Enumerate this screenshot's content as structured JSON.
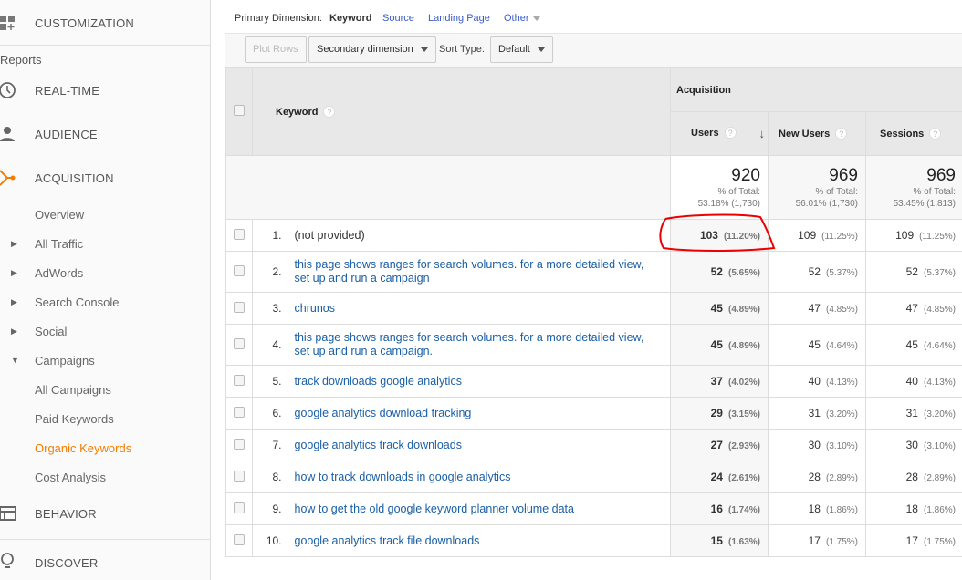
{
  "sidebar": {
    "customization": "CUSTOMIZATION",
    "reports": "Reports",
    "realtime": "REAL-TIME",
    "audience": "AUDIENCE",
    "acquisition": "ACQUISITION",
    "sub": [
      "Overview",
      "All Traffic",
      "AdWords",
      "Search Console",
      "Social",
      "Campaigns",
      "All Campaigns",
      "Paid Keywords",
      "Organic Keywords",
      "Cost Analysis"
    ],
    "behavior": "BEHAVIOR",
    "discover": "DISCOVER",
    "accent": "#f57c00"
  },
  "primary": {
    "label": "Primary Dimension:",
    "active": "Keyword",
    "source": "Source",
    "landing": "Landing Page",
    "other": "Other"
  },
  "toolbar": {
    "plot_rows": "Plot Rows",
    "secondary": "Secondary dimension",
    "sort_label": "Sort Type:",
    "sort_value": "Default"
  },
  "table": {
    "keyword_header": "Keyword",
    "group": "Acquisition",
    "cols": [
      "Users",
      "New Users",
      "Sessions"
    ],
    "totals": [
      {
        "value": "920",
        "label": "% of Total:",
        "detail": "53.18% (1,730)"
      },
      {
        "value": "969",
        "label": "% of Total:",
        "detail": "56.01% (1,730)"
      },
      {
        "value": "969",
        "label": "% of Total:",
        "detail": "53.45% (1,813)"
      }
    ],
    "rows": [
      {
        "idx": "1.",
        "kw": "(not provided)",
        "u": "103",
        "up": "(11.20%)",
        "n": "109",
        "np": "(11.25%)",
        "s": "109",
        "sp": "(11.25%)"
      },
      {
        "idx": "2.",
        "kw": "this page shows ranges for search volumes. for a more detailed view, set up and run a campaign",
        "u": "52",
        "up": "(5.65%)",
        "n": "52",
        "np": "(5.37%)",
        "s": "52",
        "sp": "(5.37%)"
      },
      {
        "idx": "3.",
        "kw": "chrunos",
        "u": "45",
        "up": "(4.89%)",
        "n": "47",
        "np": "(4.85%)",
        "s": "47",
        "sp": "(4.85%)"
      },
      {
        "idx": "4.",
        "kw": "this page shows ranges for search volumes. for a more detailed view, set up and run a campaign.",
        "u": "45",
        "up": "(4.89%)",
        "n": "45",
        "np": "(4.64%)",
        "s": "45",
        "sp": "(4.64%)"
      },
      {
        "idx": "5.",
        "kw": "track downloads google analytics",
        "u": "37",
        "up": "(4.02%)",
        "n": "40",
        "np": "(4.13%)",
        "s": "40",
        "sp": "(4.13%)"
      },
      {
        "idx": "6.",
        "kw": "google analytics download tracking",
        "u": "29",
        "up": "(3.15%)",
        "n": "31",
        "np": "(3.20%)",
        "s": "31",
        "sp": "(3.20%)"
      },
      {
        "idx": "7.",
        "kw": "google analytics track downloads",
        "u": "27",
        "up": "(2.93%)",
        "n": "30",
        "np": "(3.10%)",
        "s": "30",
        "sp": "(3.10%)"
      },
      {
        "idx": "8.",
        "kw": "how to track downloads in google analytics",
        "u": "24",
        "up": "(2.61%)",
        "n": "28",
        "np": "(2.89%)",
        "s": "28",
        "sp": "(2.89%)"
      },
      {
        "idx": "9.",
        "kw": "how to get the old google keyword planner volume data",
        "u": "16",
        "up": "(1.74%)",
        "n": "18",
        "np": "(1.86%)",
        "s": "18",
        "sp": "(1.86%)"
      },
      {
        "idx": "10.",
        "kw": "google analytics track file downloads",
        "u": "15",
        "up": "(1.63%)",
        "n": "17",
        "np": "(1.75%)",
        "s": "17",
        "sp": "(1.75%)"
      }
    ]
  }
}
